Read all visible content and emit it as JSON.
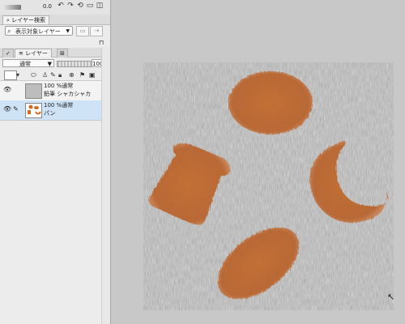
{
  "topbar": {
    "val_row1": "0.0",
    "val_row2": "0.0"
  },
  "layer_search": {
    "tab_label": "レイヤー検索",
    "search_value": "表示対象レイヤー"
  },
  "layer_panel": {
    "tab_label": "レイヤー",
    "blend_mode": "通常",
    "opacity": "100",
    "layers": [
      {
        "blend": "100 %通常",
        "name": "鉛筆 シャカシャカ"
      },
      {
        "blend": "100 %通常",
        "name": "パン"
      }
    ]
  },
  "colors": {
    "bread": "#c46c2a",
    "canvas_bg": "#b8b8b8",
    "workspace": "#c8c8c8",
    "panel": "#ececec",
    "active_layer": "#cfe3f6"
  },
  "icons": [
    "eye-icon",
    "pencil-icon",
    "search-icon",
    "chevron-down-icon",
    "move-cursor-icon"
  ]
}
